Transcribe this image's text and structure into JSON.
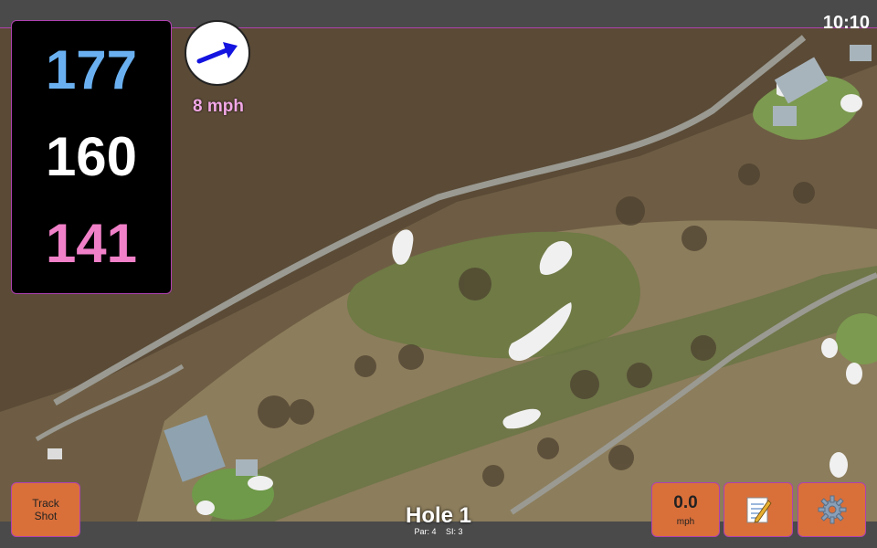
{
  "status": {
    "time": "10:10"
  },
  "distances": {
    "back": "177",
    "middle": "160",
    "front": "141"
  },
  "wind": {
    "speed": "8 mph",
    "direction_icon": "arrow-right-icon"
  },
  "hole": {
    "title": "Hole 1",
    "par": "Par: 4",
    "si": "SI: 3"
  },
  "buttons": {
    "track_shot_line1": "Track",
    "track_shot_line2": "Shot",
    "speed_value": "0.0",
    "speed_unit": "mph",
    "notes_icon": "memo-icon",
    "settings_icon": "gear-icon"
  },
  "colors": {
    "back": "#6ab0f0",
    "middle": "#ffffff",
    "front": "#f080c8",
    "button": "#d9703a",
    "accent_border": "#b040b0"
  }
}
